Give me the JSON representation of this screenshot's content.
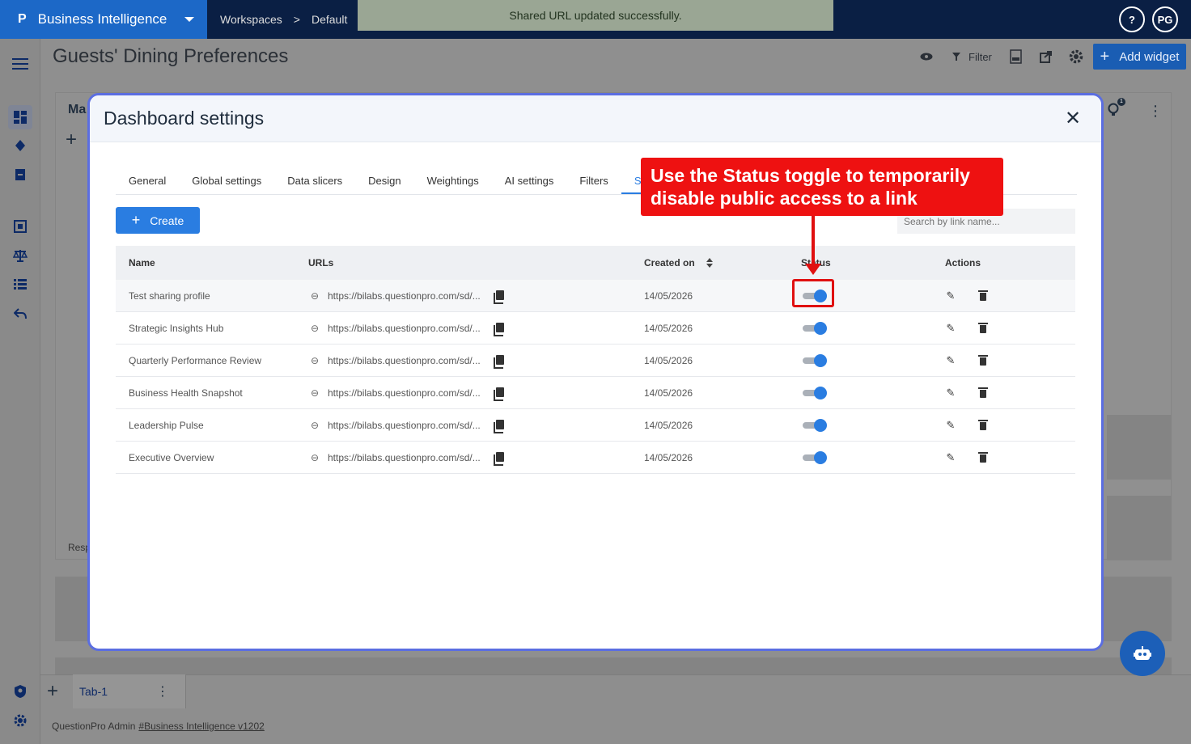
{
  "topbar": {
    "brand_label": "Business Intelligence",
    "crumb_workspaces": "Workspaces",
    "crumb_default": "Default",
    "crumb_sep": ">",
    "toast": "Shared URL updated successfully.",
    "help": "?",
    "avatar": "PG"
  },
  "header": {
    "title": "Guests' Dining Preferences",
    "filter_label": "Filter",
    "add_widget_label": "Add widget"
  },
  "background": {
    "widget_title_fragment": "Ma",
    "widget_footer_fragment": "Resp",
    "notif_badge": "1"
  },
  "bottom": {
    "tab_label": "Tab-1",
    "footer_text": "QuestionPro Admin",
    "footer_link": "#Business Intelligence v1202"
  },
  "modal": {
    "title": "Dashboard settings",
    "tabs": [
      "General",
      "Global settings",
      "Data slicers",
      "Design",
      "Weightings",
      "AI settings",
      "Filters",
      "Shared"
    ],
    "active_tab": "Shared",
    "create_label": "Create",
    "search_placeholder": "Search by link name...",
    "columns": {
      "name": "Name",
      "urls": "URLs",
      "created": "Created on",
      "status": "Status",
      "actions": "Actions"
    },
    "rows": [
      {
        "name": "Test sharing profile",
        "url": "https://bilabs.questionpro.com/sd/...",
        "created": "14/05/2026",
        "status_on": true
      },
      {
        "name": "Strategic Insights Hub",
        "url": "https://bilabs.questionpro.com/sd/...",
        "created": "14/05/2026",
        "status_on": true
      },
      {
        "name": "Quarterly Performance Review",
        "url": "https://bilabs.questionpro.com/sd/...",
        "created": "14/05/2026",
        "status_on": true
      },
      {
        "name": "Business Health Snapshot",
        "url": "https://bilabs.questionpro.com/sd/...",
        "created": "14/05/2026",
        "status_on": true
      },
      {
        "name": "Leadership Pulse",
        "url": "https://bilabs.questionpro.com/sd/...",
        "created": "14/05/2026",
        "status_on": true
      },
      {
        "name": "Executive Overview",
        "url": "https://bilabs.questionpro.com/sd/...",
        "created": "14/05/2026",
        "status_on": true
      }
    ]
  },
  "annotation": {
    "text": "Use the Status toggle to temporarily disable public access to a link",
    "color": "#ee1111"
  },
  "colors": {
    "brand_blue": "#1c68c7",
    "accent": "#2a7de1",
    "topbar": "#0a1f44",
    "modal_border": "#5b6ee1"
  }
}
